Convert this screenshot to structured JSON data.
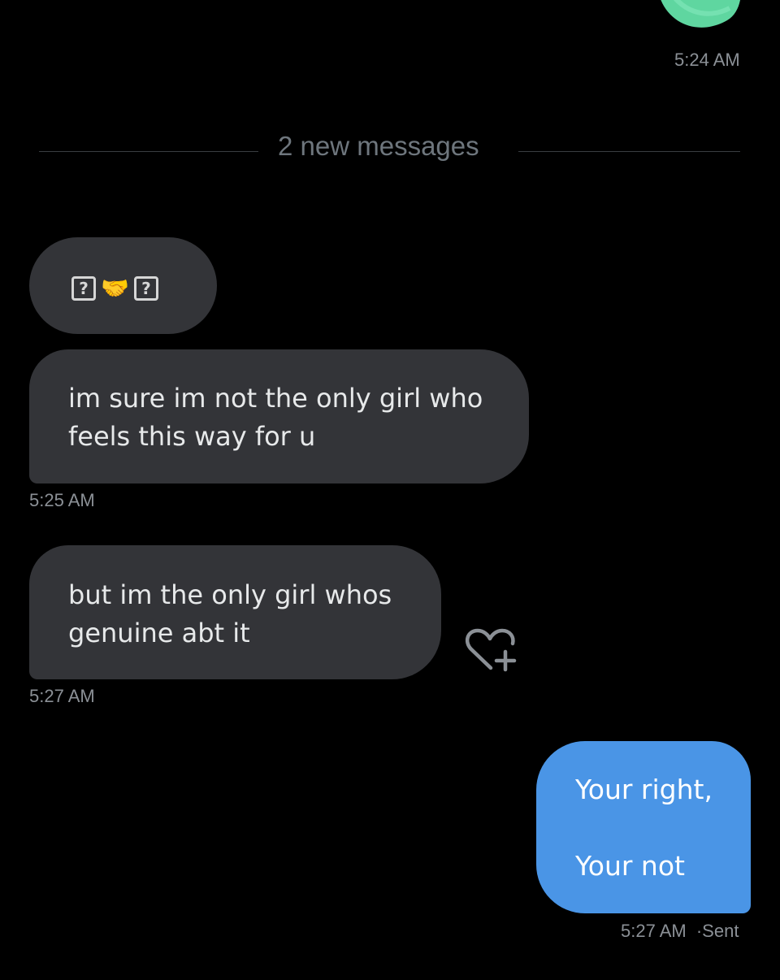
{
  "top_message": {
    "sticker_icon": "green-sticker-icon",
    "time": "5:24 AM"
  },
  "divider": {
    "label": "2 new messages"
  },
  "messages_in": [
    {
      "emoji_glyphs": [
        "?",
        "🤝",
        "?"
      ]
    },
    {
      "line1": "im sure im not the only girl who",
      "line2": "feels this way for u",
      "time": "5:25 AM"
    },
    {
      "line1": "but im the only girl whos",
      "line2": "genuine abt it",
      "time": "5:27 AM",
      "reaction_icon": "heart-plus-icon"
    }
  ],
  "message_out": {
    "line1": "Your right,",
    "line2": "Your not",
    "time": "5:27 AM",
    "status": "Sent",
    "separator": "·"
  },
  "colors": {
    "background": "#000000",
    "incoming_bubble": "#333438",
    "outgoing_bubble": "#4a95e6",
    "timestamp": "#8b9096"
  }
}
